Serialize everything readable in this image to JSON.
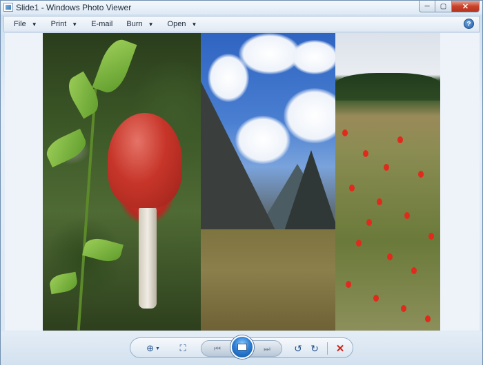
{
  "window": {
    "title": "Slide1 - Windows Photo Viewer",
    "minimize_glyph": "─",
    "maximize_glyph": "▢",
    "close_glyph": "✕"
  },
  "menu": {
    "items": [
      {
        "label": "File",
        "has_dropdown": true
      },
      {
        "label": "Print",
        "has_dropdown": true
      },
      {
        "label": "E-mail",
        "has_dropdown": false
      },
      {
        "label": "Burn",
        "has_dropdown": true
      },
      {
        "label": "Open",
        "has_dropdown": true
      }
    ],
    "caret_glyph": "▼",
    "help_glyph": "?"
  },
  "toolbar": {
    "zoom_glyph": "⊕",
    "zoom_dropdown_glyph": "▼",
    "fit_glyph": "⛶",
    "previous_glyph": "⏮",
    "next_glyph": "⏭",
    "rotate_left_glyph": "↺",
    "rotate_right_glyph": "↻",
    "delete_glyph": "✕",
    "icons": [
      "zoom-icon",
      "actual-size-icon",
      "previous-icon",
      "slideshow-icon",
      "next-icon",
      "rotate-counterclockwise-icon",
      "rotate-clockwise-icon",
      "delete-icon"
    ]
  },
  "colors": {
    "delete": "#d0251c",
    "accent": "#1f5fa8",
    "frame": "#6e8eb0"
  }
}
